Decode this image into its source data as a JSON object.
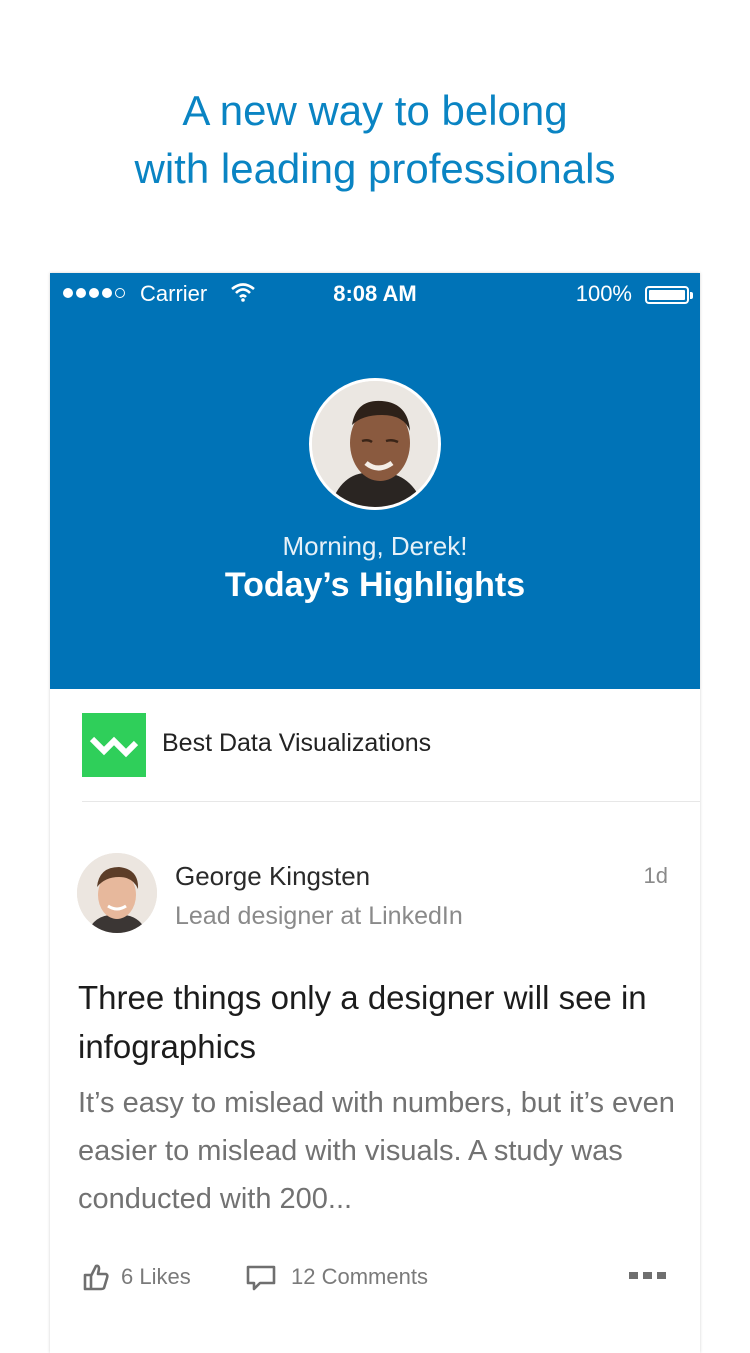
{
  "promo": {
    "tagline_line1": "A new way to belong",
    "tagline_line2": "with leading professionals"
  },
  "status_bar": {
    "signal_filled": 4,
    "signal_total": 5,
    "carrier": "Carrier",
    "time": "8:08 AM",
    "battery": "100%",
    "battery_level": 1.0
  },
  "hero": {
    "greeting": "Morning, Derek!",
    "title": "Today’s Highlights",
    "background_color": "#0073b7"
  },
  "topic": {
    "label": "Best Data Visualizations",
    "icon": "line-chart-icon",
    "icon_color": "#2fcf5a"
  },
  "post": {
    "author_name": "George Kingsten",
    "author_title": "Lead designer at LinkedIn",
    "age": "1d",
    "headline": "Three things only a designer will see in infographics",
    "excerpt": "It’s easy to mislead with numbers, but it’s even easier to mislead with visuals. A study was conducted with 200...",
    "likes_label": "6 Likes",
    "comments_label": "12 Comments"
  }
}
